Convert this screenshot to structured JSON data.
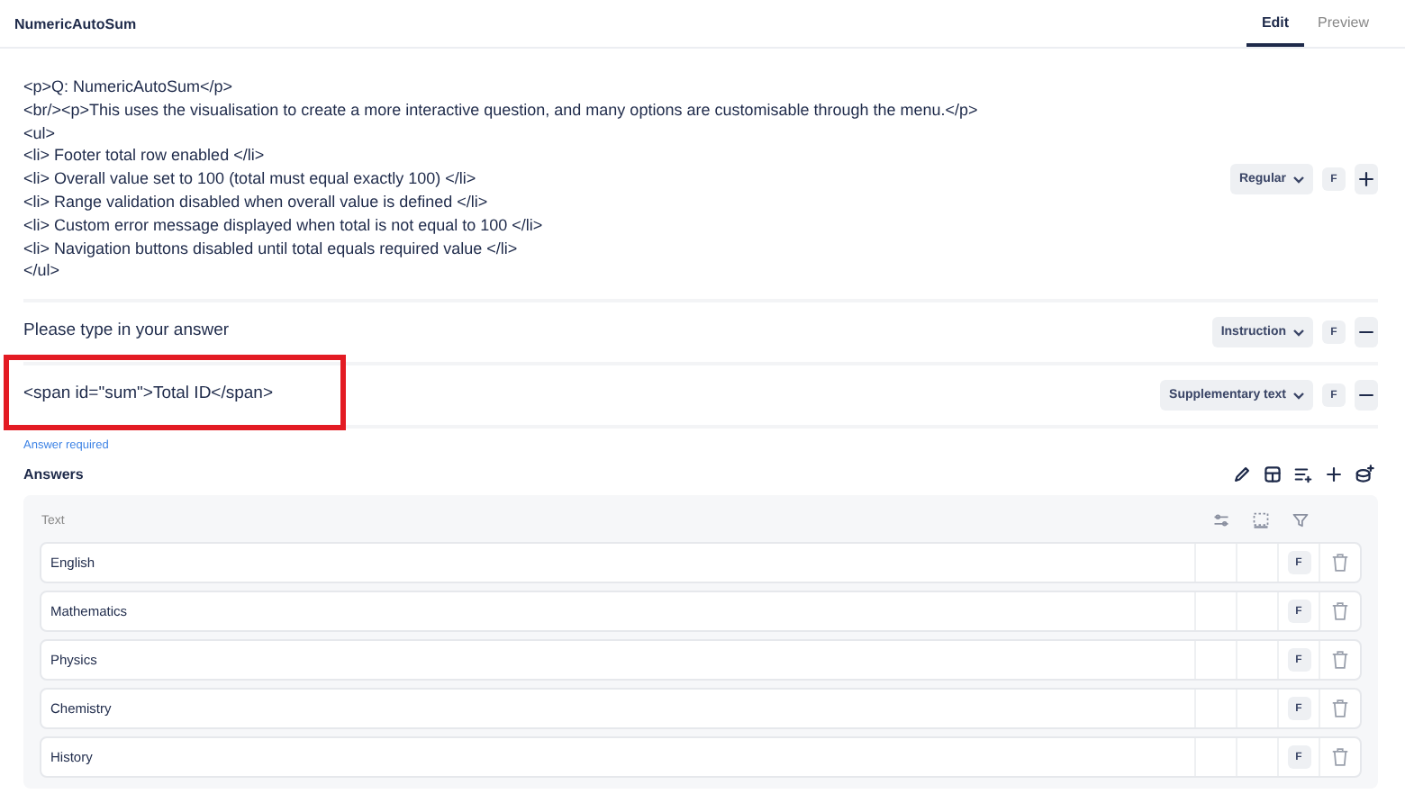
{
  "header": {
    "title": "NumericAutoSum",
    "tabs": [
      {
        "label": "Edit",
        "selected": true
      },
      {
        "label": "Preview",
        "selected": false
      }
    ]
  },
  "blocks": [
    {
      "lines": [
        "<p>Q: NumericAutoSum</p>",
        "<br/><p>This uses the visualisation to create a more interactive question, and many options are customisable through the menu.</p>",
        "<ul>",
        "<li> Footer total row enabled </li>",
        "<li> Overall value set to 100 (total must equal exactly 100) </li>",
        "<li> Range validation disabled when overall value is defined </li>",
        "<li> Custom error message displayed when total is not equal to 100 </li>",
        "<li> Navigation buttons disabled until total equals required value </li>",
        "</ul>"
      ],
      "style": "Regular",
      "format": "F",
      "kind": "add",
      "highlighted": false
    },
    {
      "lines": [
        "Please type in your answer"
      ],
      "style": "Instruction",
      "format": "F",
      "kind": "remove",
      "highlighted": false
    },
    {
      "lines": [
        "<span id=\"sum\">Total ID</span>"
      ],
      "style": "Supplementary text",
      "format": "F",
      "kind": "remove",
      "highlighted": true
    }
  ],
  "validation": "Answer required",
  "answers": {
    "title": "Answers",
    "column": "Text",
    "rows": [
      {
        "text": "English",
        "format": "F"
      },
      {
        "text": "Mathematics",
        "format": "F"
      },
      {
        "text": "Physics",
        "format": "F"
      },
      {
        "text": "Chemistry",
        "format": "F"
      },
      {
        "text": "History",
        "format": "F"
      }
    ]
  }
}
